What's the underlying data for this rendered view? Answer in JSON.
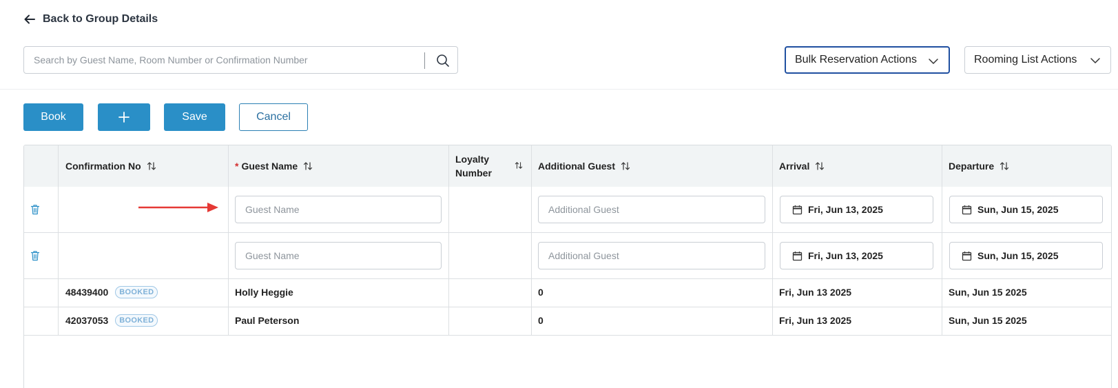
{
  "header": {
    "back_label": "Back to Group Details"
  },
  "search": {
    "placeholder": "Search by Guest Name, Room Number or Confirmation Number",
    "value": ""
  },
  "actions": {
    "bulk_label": "Bulk Reservation Actions",
    "rooming_label": "Rooming List Actions"
  },
  "toolbar": {
    "book_label": "Book",
    "save_label": "Save",
    "cancel_label": "Cancel"
  },
  "table": {
    "columns": {
      "confirmation": "Confirmation No",
      "guest_required_mark": "*",
      "guest": "Guest Name",
      "loyalty_line1": "Loyalty",
      "loyalty_line2": "Number",
      "additional": "Additional Guest",
      "arrival": "Arrival",
      "departure": "Departure"
    },
    "edit_rows": [
      {
        "guest_placeholder": "Guest Name",
        "additional_placeholder": "Additional Guest",
        "arrival": "Fri, Jun 13, 2025",
        "departure": "Sun, Jun 15, 2025"
      },
      {
        "guest_placeholder": "Guest Name",
        "additional_placeholder": "Additional Guest",
        "arrival": "Fri, Jun 13, 2025",
        "departure": "Sun, Jun 15, 2025"
      }
    ],
    "rows": [
      {
        "confirmation": "48439400",
        "status": "BOOKED",
        "guest": "Holly Heggie",
        "additional": "0",
        "arrival": "Fri, Jun 13 2025",
        "departure": "Sun, Jun 15 2025"
      },
      {
        "confirmation": "42037053",
        "status": "BOOKED",
        "guest": "Paul Peterson",
        "additional": "0",
        "arrival": "Fri, Jun 13 2025",
        "departure": "Sun, Jun 15 2025"
      }
    ]
  },
  "colors": {
    "primary": "#2a8fc7",
    "focus_border": "#1f4fa0",
    "badge": "#7fb1d8",
    "annotation_arrow": "#e53935"
  },
  "icons": {
    "back": "arrow-left-icon",
    "search": "search-icon",
    "dropdown": "chevron-down-icon",
    "add": "plus-icon",
    "sort": "sort-icon",
    "delete": "trash-icon",
    "date": "calendar-icon"
  }
}
